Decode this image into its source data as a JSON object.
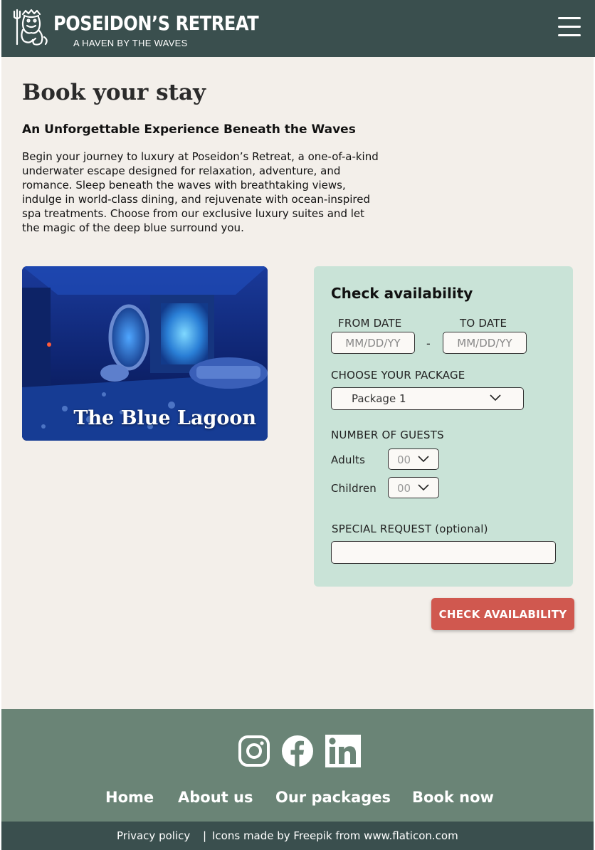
{
  "header": {
    "brand_title": "POSEIDON’S RETREAT",
    "brand_subtitle": "A HAVEN BY THE WAVES",
    "logo_icon": "poseidon-trident-icon",
    "menu_icon": "hamburger-menu-icon"
  },
  "main": {
    "title": "Book your stay",
    "subtitle": "An Unforgettable Experience Beneath the Waves",
    "intro": "Begin your journey to luxury at Poseidon’s Retreat, a one-of-a-kind underwater escape designed for relaxation, adventure, and romance. Sleep beneath the waves with breathtaking views, indulge in world-class dining, and rejuvenate with ocean-inspired spa treatments. Choose from our exclusive luxury suites and let the magic of the deep blue surround you.",
    "image_caption": "The Blue Lagoon"
  },
  "form": {
    "title": "Check availability",
    "from_label": "FROM DATE",
    "to_label": "TO DATE",
    "from_placeholder": "MM/DD/YY",
    "to_placeholder": "MM/DD/YY",
    "date_separator": "-",
    "package_label": "CHOOSE YOUR PACKAGE",
    "package_value": "Package 1",
    "guests_label": "NUMBER OF GUESTS",
    "adults_label": "Adults",
    "adults_value": "00",
    "children_label": "Children",
    "children_value": "00",
    "request_label": "SPECIAL REQUEST (optional)",
    "request_value": "",
    "submit_label": "CHECK AVAILABILITY"
  },
  "footer": {
    "social": [
      "instagram-icon",
      "facebook-icon",
      "linkedin-icon"
    ],
    "nav": [
      "Home",
      "About us",
      "Our packages",
      "Book now"
    ],
    "privacy": "Privacy policy",
    "separator": "|",
    "credits": "Icons made by Freepik from www.flaticon.com"
  },
  "colors": {
    "header_bg": "#3a4f4e",
    "page_bg": "#f3efea",
    "panel_bg": "#c9e3d7",
    "cta_bg": "#d0584f",
    "footer_bg": "#6a8476"
  }
}
